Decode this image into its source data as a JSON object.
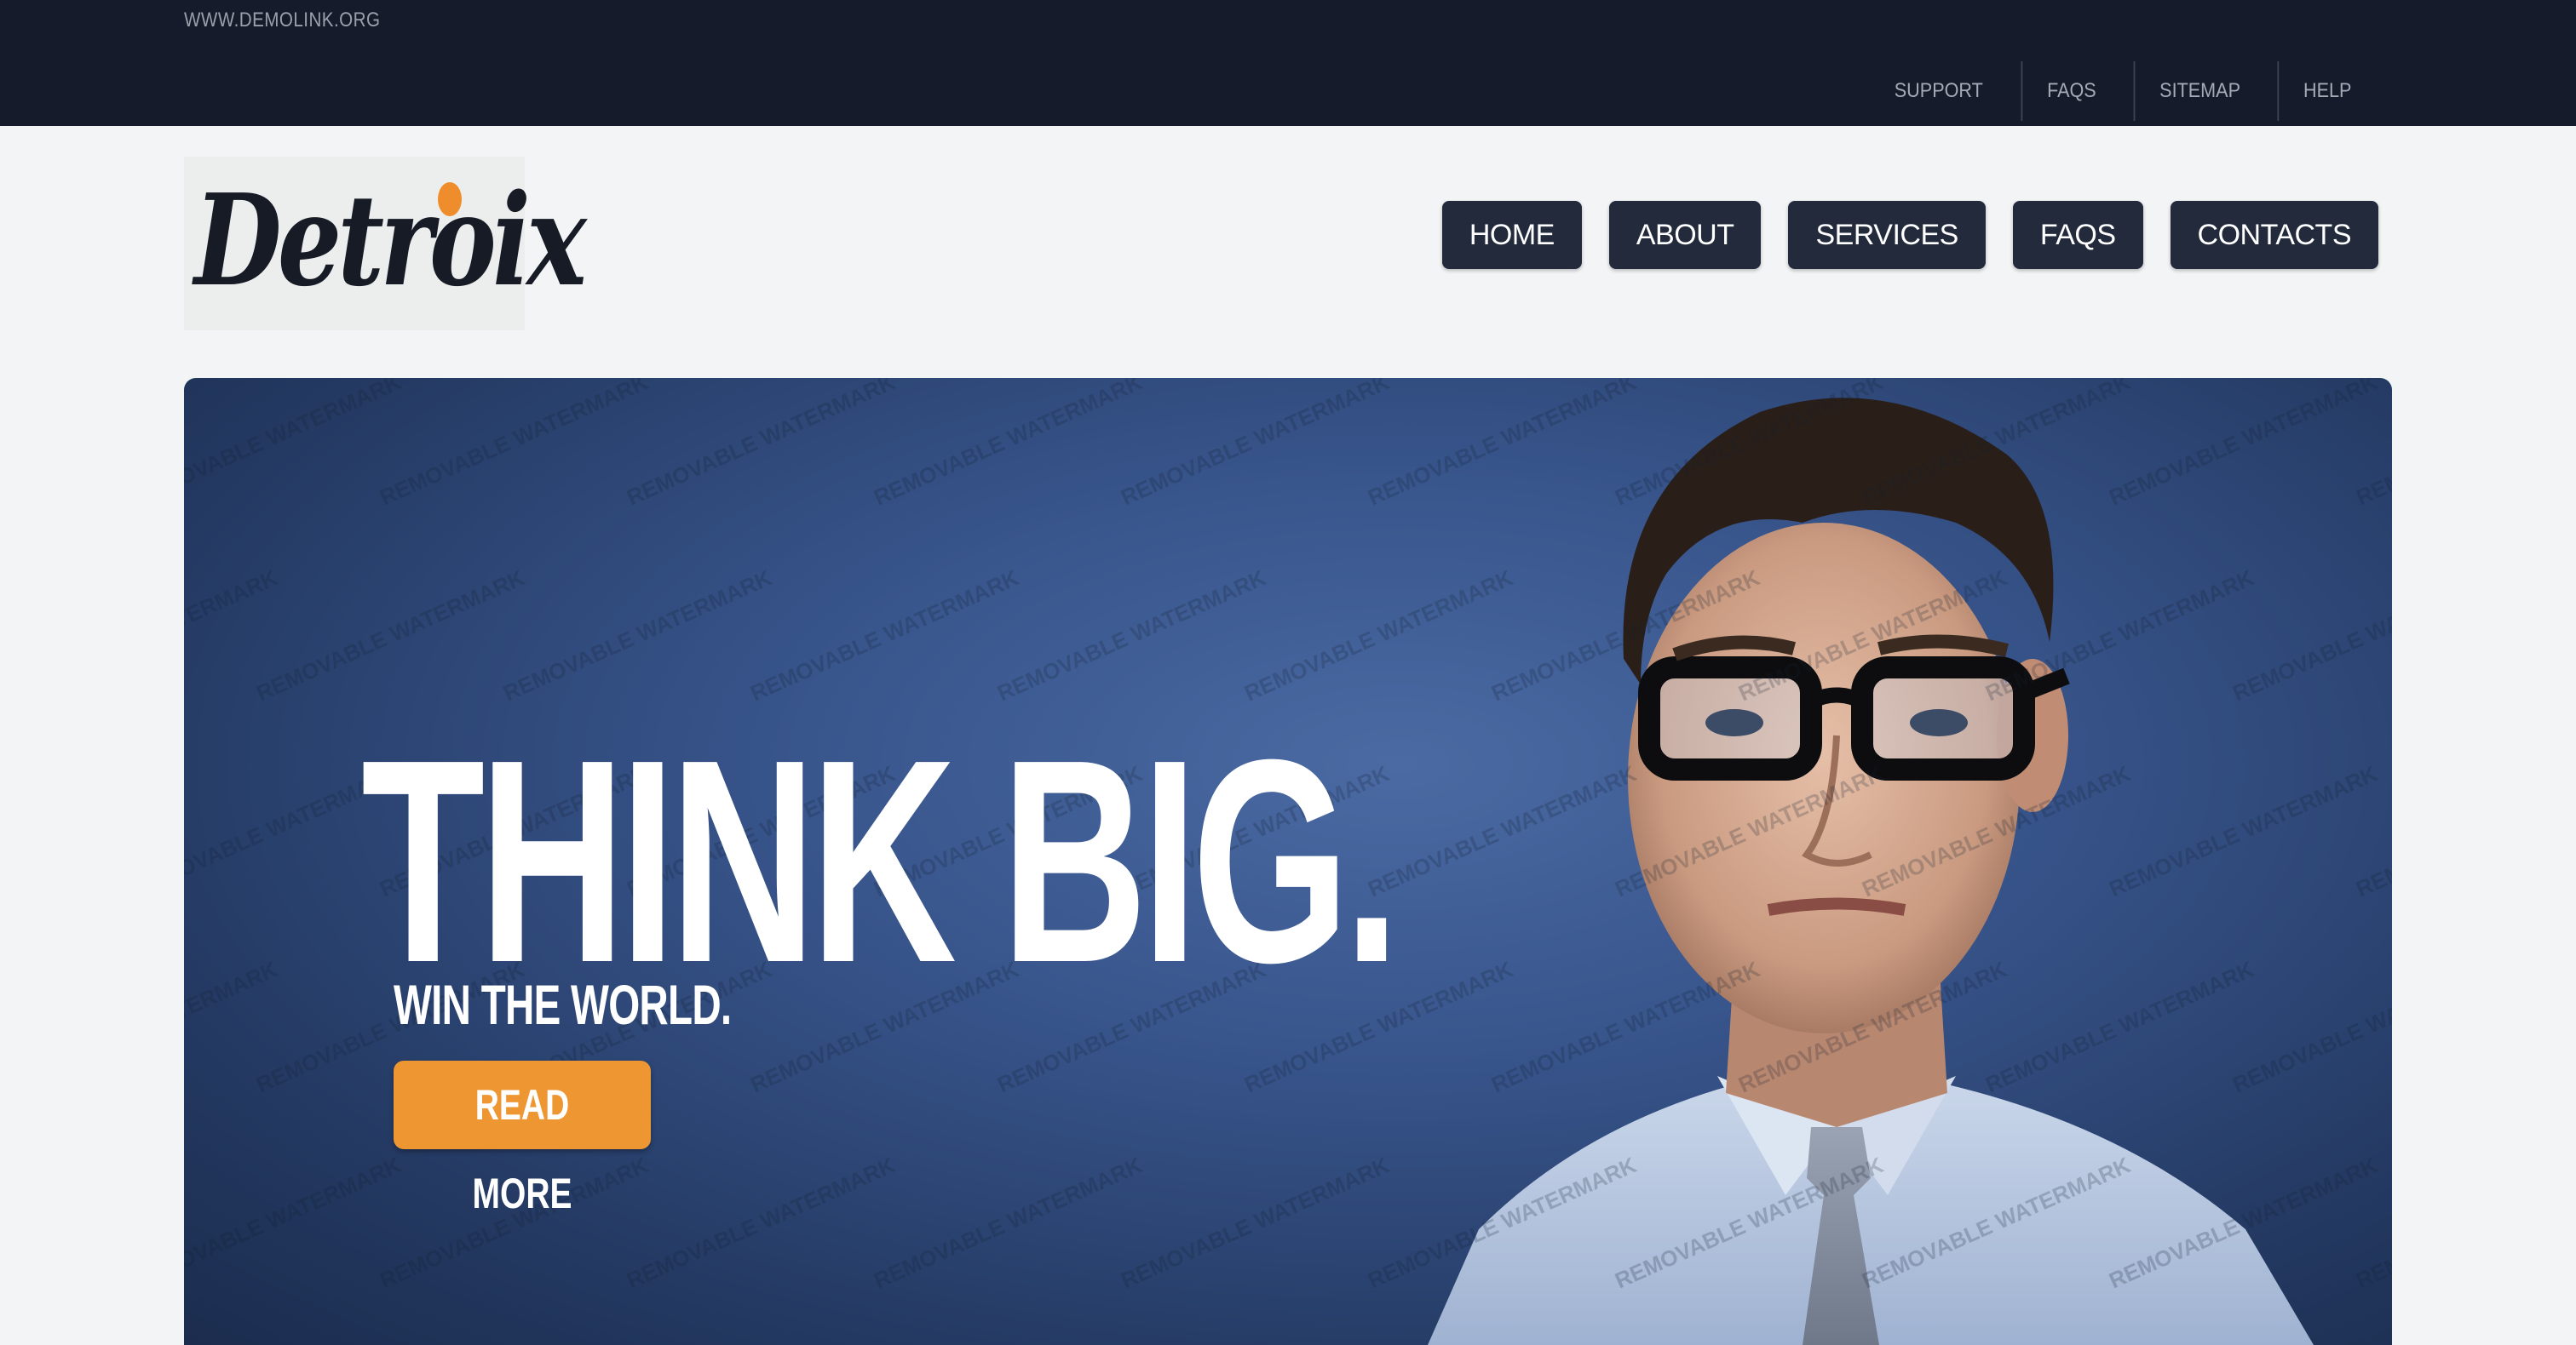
{
  "top_bar": {
    "site_url": "WWW.DEMOLINK.ORG",
    "links": [
      "SUPPORT",
      "FAQS",
      "SITEMAP",
      "HELP"
    ]
  },
  "header": {
    "logo_text": "Detroix",
    "nav": [
      "HOME",
      "ABOUT",
      "SERVICES",
      "FAQS",
      "CONTACTS"
    ]
  },
  "hero": {
    "headline": "THINK BIG.",
    "subheadline": "WIN THE WORLD.",
    "cta_label": "READ MORE",
    "watermark_text": "REMOVABLE WATERMARK"
  },
  "colors": {
    "top_bar_bg": "#151b2b",
    "nav_button_bg": "#222a3b",
    "accent_orange": "#ee9632",
    "page_bg": "#f3f4f6",
    "hero_blue": "#38558c"
  }
}
